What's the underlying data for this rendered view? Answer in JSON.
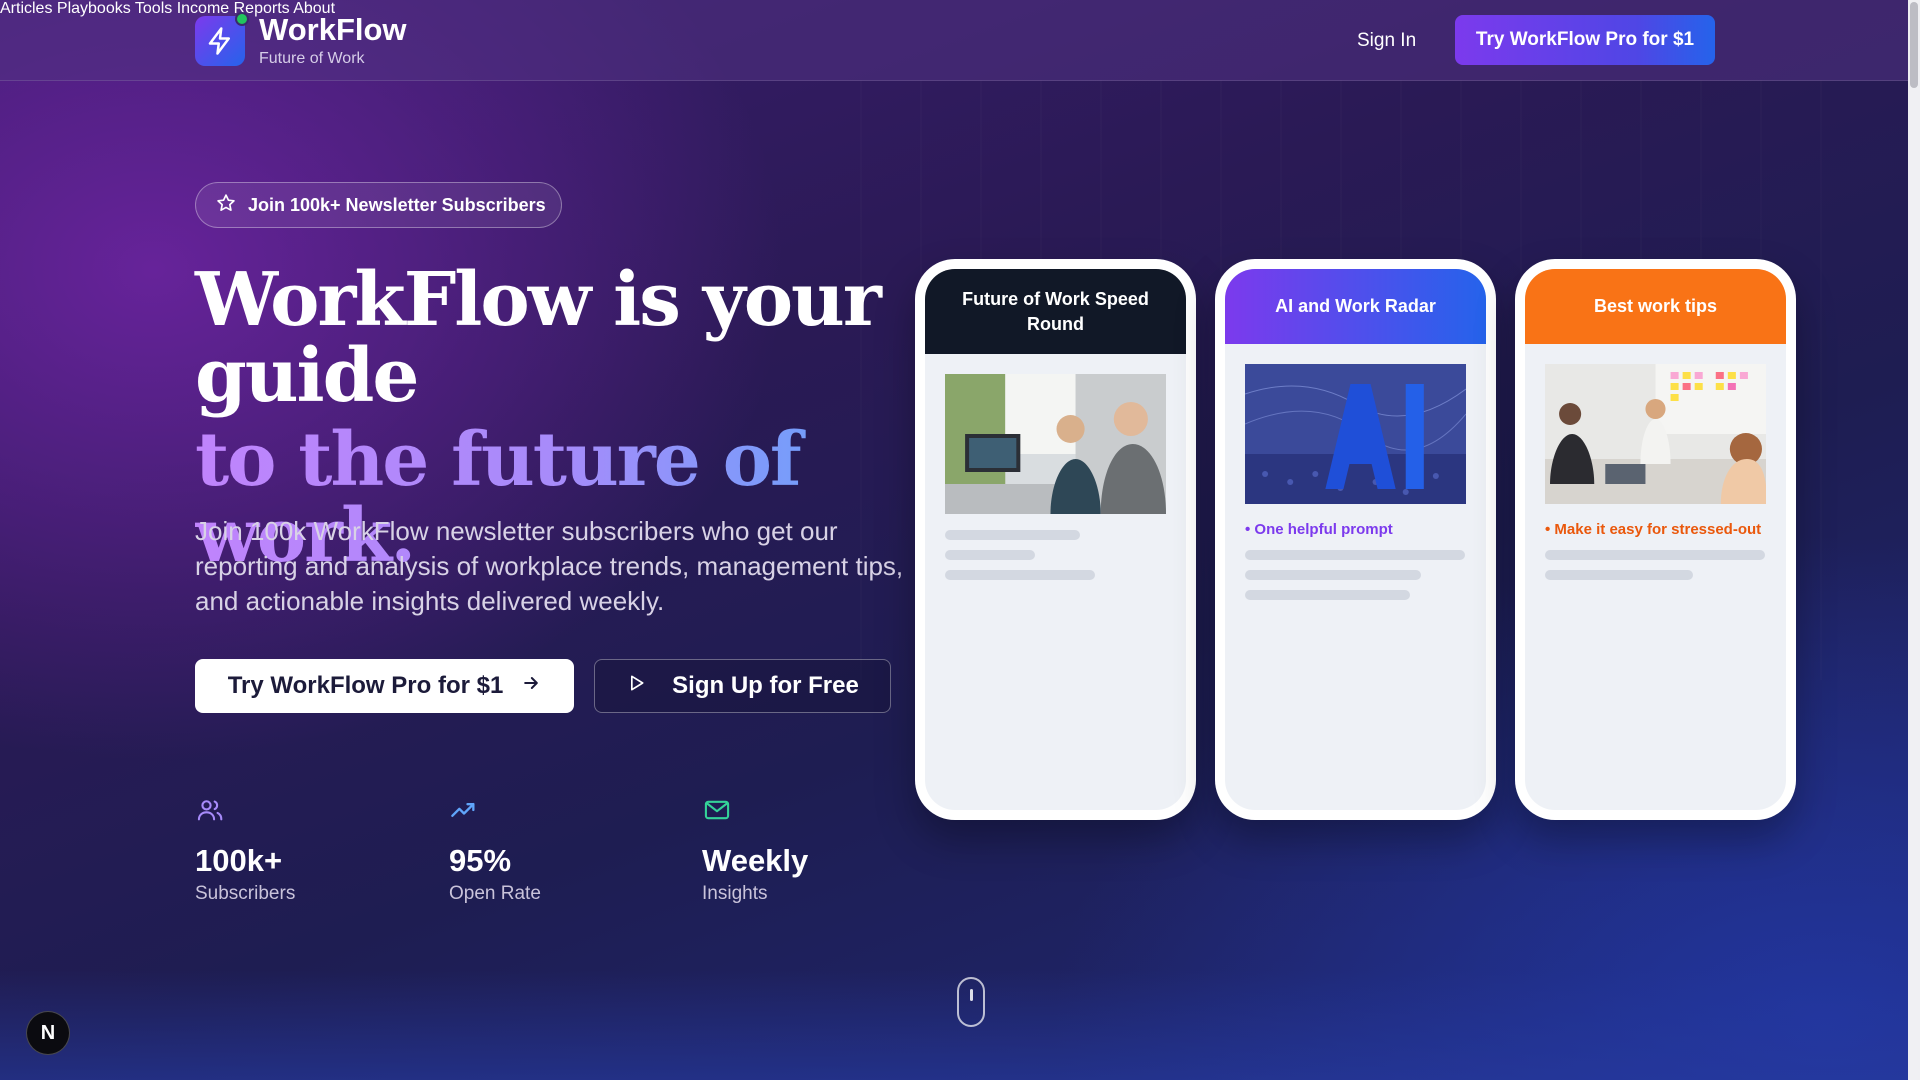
{
  "brand": {
    "name": "WorkFlow",
    "tagline": "Future of Work"
  },
  "nav": {
    "items": [
      "Articles",
      "Playbooks",
      "Tools",
      "Income Reports",
      "About"
    ]
  },
  "header": {
    "signin": "Sign In",
    "cta": "Try WorkFlow Pro for $1"
  },
  "hero": {
    "badge": "Join 100k+ Newsletter Subscribers",
    "headline_line1": "WorkFlow is your guide",
    "headline_line2": "to the future of work.",
    "lede": "Join 100k WorkFlow newsletter subscribers who get our reporting and analysis of workplace trends, management tips, and actionable insights delivered weekly.",
    "primary_cta": "Try WorkFlow Pro for $1",
    "secondary_cta": "Sign Up for Free"
  },
  "stats": [
    {
      "value": "100k+",
      "label": "Subscribers",
      "icon": "users-icon",
      "color": "#a78bfa"
    },
    {
      "value": "95%",
      "label": "Open Rate",
      "icon": "trending-up-icon",
      "color": "#60a5fa"
    },
    {
      "value": "Weekly",
      "label": "Insights",
      "icon": "mail-icon",
      "color": "#34d399"
    }
  ],
  "cards": [
    {
      "title": "Future of Work Speed Round",
      "bullet": "",
      "header_color": "#111827"
    },
    {
      "title": "AI and Work Radar",
      "bullet": "• One helpful prompt",
      "header_color": "#7c3aed",
      "bullet_color": "#7c3aed"
    },
    {
      "title": "Best work tips",
      "bullet": "• Make it easy for stressed-out",
      "header_color": "#f97316",
      "bullet_color": "#ea580c"
    }
  ],
  "floating_badge": "N",
  "colors": {
    "accent_purple": "#7c3aed",
    "accent_blue": "#2563eb",
    "online_dot": "#22c55e"
  }
}
